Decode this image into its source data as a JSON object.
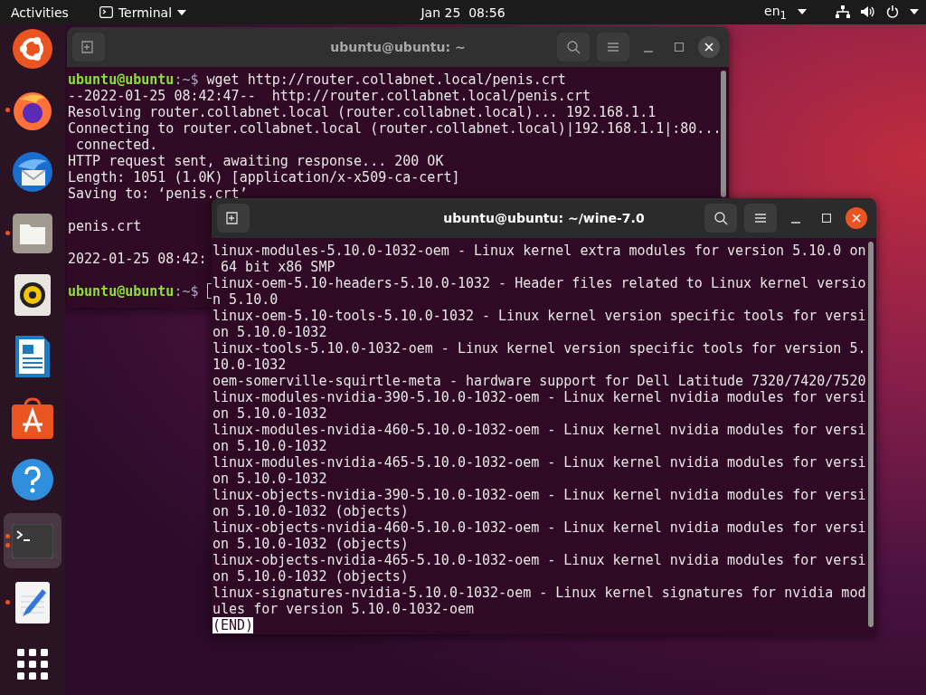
{
  "top_bar": {
    "activities": "Activities",
    "app_menu": "Terminal",
    "clock": "Jan 25  08:56",
    "input_source": "en$_{1}$"
  },
  "dock": {
    "items": [
      {
        "kind": "ubuntu",
        "running": false,
        "several_windows": false,
        "selected": false
      },
      {
        "kind": "browser",
        "running": true,
        "several_windows": false,
        "selected": false
      },
      {
        "kind": "mail",
        "running": false,
        "several_windows": false,
        "selected": false
      },
      {
        "kind": "files",
        "running": true,
        "several_windows": false,
        "selected": false
      },
      {
        "kind": "music",
        "running": false,
        "several_windows": false,
        "selected": false
      },
      {
        "kind": "writer",
        "running": false,
        "several_windows": false,
        "selected": false
      },
      {
        "kind": "store",
        "running": false,
        "several_windows": false,
        "selected": false
      },
      {
        "kind": "help",
        "running": false,
        "several_windows": false,
        "selected": false
      },
      {
        "kind": "terminal",
        "running": true,
        "several_windows": true,
        "selected": true
      },
      {
        "kind": "editor",
        "running": true,
        "several_windows": false,
        "selected": false
      },
      {
        "kind": "apps",
        "running": false,
        "several_windows": false,
        "selected": false
      }
    ]
  },
  "windows": [
    {
      "title": "ubuntu@ubuntu: ~",
      "focused": false,
      "lines": [
        {
          "kind": "prompt",
          "user": "ubuntu@ubuntu",
          "path": ":~$",
          "command": "wget http://router.collabnet.local/penis.crt"
        },
        {
          "kind": "output",
          "text": "--2022-01-25 08:42:47--  http://router.collabnet.local/penis.crt"
        },
        {
          "kind": "output",
          "text": "Resolving router.collabnet.local (router.collabnet.local)... 192.168.1.1"
        },
        {
          "kind": "output",
          "text": "Connecting to router.collabnet.local (router.collabnet.local)|192.168.1.1|:80..."
        },
        {
          "kind": "output",
          "text": " connected."
        },
        {
          "kind": "output",
          "text": "HTTP request sent, awaiting response... 200 OK"
        },
        {
          "kind": "output",
          "text": "Length: 1051 (1.0K) [application/x-x509-ca-cert]"
        },
        {
          "kind": "output",
          "text": "Saving to: ‘penis.crt’"
        },
        {
          "kind": "blank"
        },
        {
          "kind": "output",
          "text": "penis.crt"
        },
        {
          "kind": "blank"
        },
        {
          "kind": "output",
          "text": "2022-01-25 08:42:"
        },
        {
          "kind": "blank"
        },
        {
          "kind": "prompt",
          "user": "ubuntu@ubuntu",
          "path": ":~$",
          "cursor": true
        }
      ]
    },
    {
      "title": "ubuntu@ubuntu: ~/wine-7.0",
      "focused": true,
      "lines": [
        {
          "kind": "output",
          "text": "linux-modules-5.10.0-1032-oem - Linux kernel extra modules for version 5.10.0 on"
        },
        {
          "kind": "output",
          "text": " 64 bit x86 SMP"
        },
        {
          "kind": "output",
          "text": "linux-oem-5.10-headers-5.10.0-1032 - Header files related to Linux kernel versio"
        },
        {
          "kind": "output",
          "text": "n 5.10.0"
        },
        {
          "kind": "output",
          "text": "linux-oem-5.10-tools-5.10.0-1032 - Linux kernel version specific tools for versi"
        },
        {
          "kind": "output",
          "text": "on 5.10.0-1032"
        },
        {
          "kind": "output",
          "text": "linux-tools-5.10.0-1032-oem - Linux kernel version specific tools for version 5."
        },
        {
          "kind": "output",
          "text": "10.0-1032"
        },
        {
          "kind": "output",
          "text": "oem-somerville-squirtle-meta - hardware support for Dell Latitude 7320/7420/7520"
        },
        {
          "kind": "output",
          "text": "linux-modules-nvidia-390-5.10.0-1032-oem - Linux kernel nvidia modules for versi"
        },
        {
          "kind": "output",
          "text": "on 5.10.0-1032"
        },
        {
          "kind": "output",
          "text": "linux-modules-nvidia-460-5.10.0-1032-oem - Linux kernel nvidia modules for versi"
        },
        {
          "kind": "output",
          "text": "on 5.10.0-1032"
        },
        {
          "kind": "output",
          "text": "linux-modules-nvidia-465-5.10.0-1032-oem - Linux kernel nvidia modules for versi"
        },
        {
          "kind": "output",
          "text": "on 5.10.0-1032"
        },
        {
          "kind": "output",
          "text": "linux-objects-nvidia-390-5.10.0-1032-oem - Linux kernel nvidia modules for versi"
        },
        {
          "kind": "output",
          "text": "on 5.10.0-1032 (objects)"
        },
        {
          "kind": "output",
          "text": "linux-objects-nvidia-460-5.10.0-1032-oem - Linux kernel nvidia modules for versi"
        },
        {
          "kind": "output",
          "text": "on 5.10.0-1032 (objects)"
        },
        {
          "kind": "output",
          "text": "linux-objects-nvidia-465-5.10.0-1032-oem - Linux kernel nvidia modules for versi"
        },
        {
          "kind": "output",
          "text": "on 5.10.0-1032 (objects)"
        },
        {
          "kind": "output",
          "text": "linux-signatures-nvidia-5.10.0-1032-oem - Linux kernel signatures for nvidia mod"
        },
        {
          "kind": "output",
          "text": "ules for version 5.10.0-1032-oem"
        },
        {
          "kind": "pager_end",
          "text": "(END)"
        }
      ]
    }
  ]
}
